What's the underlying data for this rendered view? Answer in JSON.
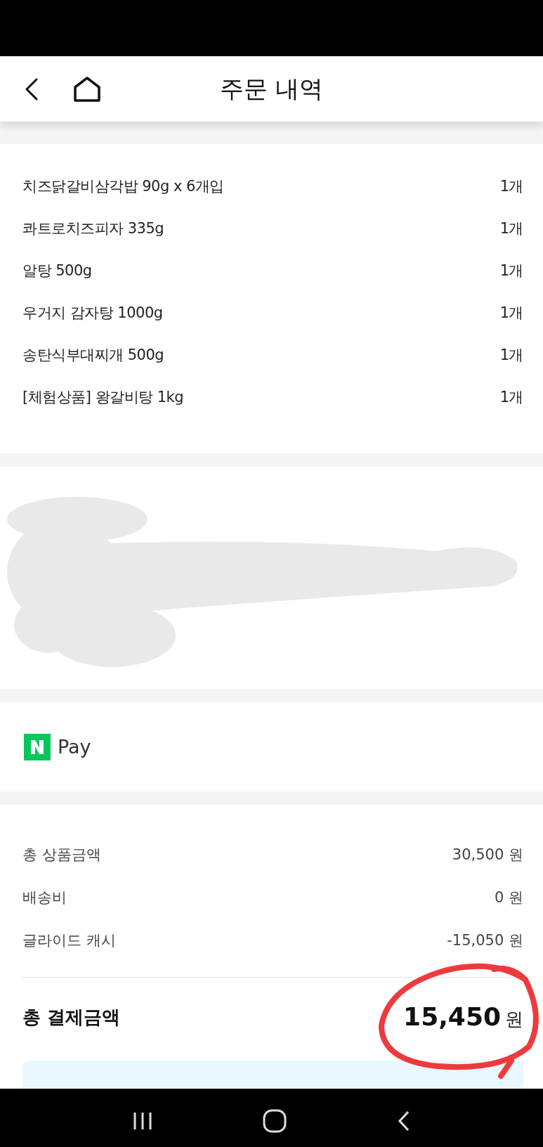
{
  "header": {
    "title": "주문 내역"
  },
  "items": [
    {
      "name": "치즈닭갈비삼각밥 90g x 6개입",
      "quantity": "1개"
    },
    {
      "name": "콰트로치즈피자 335g",
      "quantity": "1개"
    },
    {
      "name": "알탕 500g",
      "quantity": "1개"
    },
    {
      "name": "우거지 감자탕 1000g",
      "quantity": "1개"
    },
    {
      "name": "송탄식부대찌개 500g",
      "quantity": "1개"
    },
    {
      "name": "[체험상품] 왕갈비탕 1kg",
      "quantity": "1개"
    }
  ],
  "payment_method": {
    "label": "Pay"
  },
  "summary": [
    {
      "label": "총 상품금액",
      "value": "30,500 원"
    },
    {
      "label": "배송비",
      "value": "0 원"
    },
    {
      "label": "글라이드 캐시",
      "value": "-15,050 원"
    }
  ],
  "total": {
    "label": "총 결제금액",
    "amount": "15,450",
    "unit": "원"
  }
}
